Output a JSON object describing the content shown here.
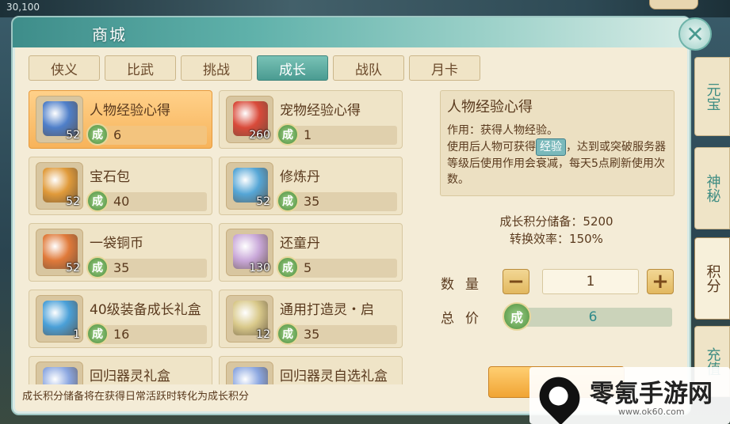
{
  "hud": {
    "left_text": "30,100"
  },
  "window": {
    "title": "商城",
    "close_symbol": "✕"
  },
  "tabs": [
    {
      "label": "侠义",
      "active": false
    },
    {
      "label": "比武",
      "active": false
    },
    {
      "label": "挑战",
      "active": false
    },
    {
      "label": "成长",
      "active": true
    },
    {
      "label": "战队",
      "active": false
    },
    {
      "label": "月卡",
      "active": false
    }
  ],
  "currency_glyph": "成",
  "items": [
    {
      "name": "人物经验心得",
      "count": "52",
      "price": "6",
      "selected": true,
      "icon": "blue-book-icon",
      "color": "#4f7fc9"
    },
    {
      "name": "宠物经验心得",
      "count": "260",
      "price": "1",
      "selected": false,
      "icon": "red-book-icon",
      "color": "#d94a3a"
    },
    {
      "name": "宝石包",
      "count": "52",
      "price": "40",
      "selected": false,
      "icon": "gem-bag-icon",
      "color": "#e09a3a"
    },
    {
      "name": "修炼丹",
      "count": "52",
      "price": "35",
      "selected": false,
      "icon": "vase-icon",
      "color": "#55a6d6"
    },
    {
      "name": "一袋铜币",
      "count": "52",
      "price": "35",
      "selected": false,
      "icon": "coin-bag-icon",
      "color": "#e07a3a"
    },
    {
      "name": "还童丹",
      "count": "130",
      "price": "5",
      "selected": false,
      "icon": "white-vase-icon",
      "color": "#c9a8d9"
    },
    {
      "name": "40级装备成长礼盒",
      "count": "1",
      "price": "16",
      "selected": false,
      "icon": "gift-chest-icon",
      "color": "#4aa0d8"
    },
    {
      "name": "通用打造灵・启",
      "count": "12",
      "price": "35",
      "selected": false,
      "icon": "forge-spirit-icon",
      "color": "#d9c98a"
    },
    {
      "name": "回归器灵礼盒",
      "count": "",
      "price": "",
      "selected": false,
      "icon": "gift-box-icon",
      "color": "#8aa6e0"
    },
    {
      "name": "回归器灵自选礼盒",
      "count": "",
      "price": "",
      "selected": false,
      "icon": "gift-box-icon",
      "color": "#8aa6e0"
    }
  ],
  "detail": {
    "title": "人物经验心得",
    "desc_prefix": "作用：获得人物经验。",
    "desc_line2_a": "使用后人物可获得",
    "highlight": "经验",
    "desc_line2_b": "，达到或突破服务器等级后使用作用会衰减，每天5点刷新使用次数。"
  },
  "growth": {
    "storage": "成长积分储备：5200",
    "efficiency": "转换效率：150%"
  },
  "purchase": {
    "qty_label": "数量",
    "qty_value": "1",
    "minus": "−",
    "plus": "+",
    "total_label": "总价",
    "total_value": "6"
  },
  "side_tabs": [
    {
      "label": "元宝",
      "active": false
    },
    {
      "label": "神秘",
      "active": false
    },
    {
      "label": "积分",
      "active": true
    },
    {
      "label": "充值",
      "active": false
    }
  ],
  "footer_note": "成长积分储备将在获得日常活跃时转化为成长积分",
  "watermark": {
    "text": "零氪手游网",
    "url": "www.ok60.com"
  },
  "colors": {
    "accent": "#4a9b91",
    "panel": "#f4ecd7",
    "selected": "#f7b35a"
  }
}
